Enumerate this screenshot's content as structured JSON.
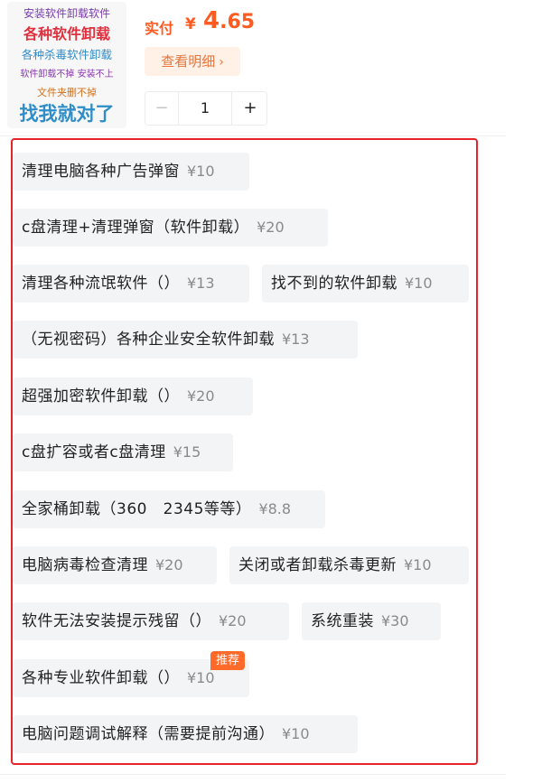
{
  "thumbnail": {
    "lines": [
      "安装软件卸载软件",
      "各种软件卸载",
      "各种杀毒软件卸载",
      "软件卸载不掉  安装不上",
      "文件夹删不掉",
      "找我就对了"
    ]
  },
  "price": {
    "label": "实付",
    "currency": "¥",
    "integer": "4",
    "decimal": ".65"
  },
  "detail_button": {
    "label": "查看明细",
    "icon": "chevron-right-icon"
  },
  "quantity": {
    "minus": "−",
    "value": "1",
    "plus": "+"
  },
  "options": [
    {
      "name": "清理电脑各种广告弹窗",
      "price": "¥10"
    },
    {
      "name": "c盘清理+清理弹窗（软件卸载）",
      "price": "¥20"
    },
    {
      "name": "清理各种流氓软件（）",
      "price": "¥13"
    },
    {
      "name": "找不到的软件卸载",
      "price": "¥10"
    },
    {
      "name": "（无视密码）各种企业安全软件卸载",
      "price": "¥13"
    },
    {
      "name": "超强加密软件卸载（）",
      "price": "¥20"
    },
    {
      "name": "c盘扩容或者c盘清理",
      "price": "¥15"
    },
    {
      "name": "全家桶卸载（360   2345等等）",
      "price": "¥8.8"
    },
    {
      "name": "电脑病毒检查清理",
      "price": "¥20"
    },
    {
      "name": "关闭或者卸载杀毒更新",
      "price": "¥10"
    },
    {
      "name": "软件无法安装提示残留（）",
      "price": "¥20"
    },
    {
      "name": "系统重装",
      "price": "¥30"
    },
    {
      "name": "各种专业软件卸载（）",
      "price": "¥10"
    },
    {
      "name": "电脑问题调试解释（需要提前沟通）",
      "price": "¥10"
    }
  ],
  "recommend_badge": "推荐",
  "colors": {
    "accent": "#ff5a1f",
    "highlight_frame": "#e8232b",
    "chip_bg": "#f3f4f6",
    "badge_bg": "#ff6a2a"
  }
}
